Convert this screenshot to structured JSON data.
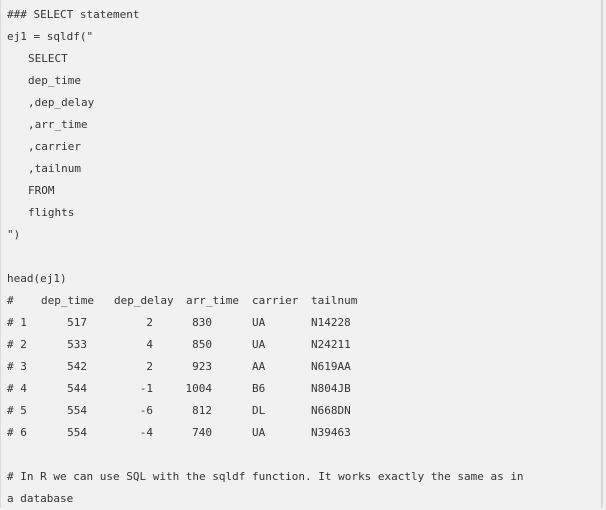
{
  "code": {
    "comment_header": "### SELECT statement",
    "assign_line": "ej1 = sqldf(\"",
    "sql_lines": [
      "SELECT",
      "dep_time",
      ",dep_delay",
      ",arr_time",
      ",carrier",
      ",tailnum",
      "FROM",
      "flights"
    ],
    "close_line": "\")",
    "head_call": "head(ej1)"
  },
  "output_table": {
    "row_prefix_header": "#",
    "columns": [
      "dep_time",
      "dep_delay",
      "arr_time",
      "carrier",
      "tailnum"
    ],
    "rows": [
      {
        "index": "# 1",
        "dep_time": "517",
        "dep_delay": "2",
        "arr_time": "830",
        "carrier": "UA",
        "tailnum": "N14228"
      },
      {
        "index": "# 2",
        "dep_time": "533",
        "dep_delay": "4",
        "arr_time": "850",
        "carrier": "UA",
        "tailnum": "N24211"
      },
      {
        "index": "# 3",
        "dep_time": "542",
        "dep_delay": "2",
        "arr_time": "923",
        "carrier": "AA",
        "tailnum": "N619AA"
      },
      {
        "index": "# 4",
        "dep_time": "544",
        "dep_delay": "-1",
        "arr_time": "1004",
        "carrier": "B6",
        "tailnum": "N804JB"
      },
      {
        "index": "# 5",
        "dep_time": "554",
        "dep_delay": "-6",
        "arr_time": "812",
        "carrier": "DL",
        "tailnum": "N668DN"
      },
      {
        "index": "# 6",
        "dep_time": "554",
        "dep_delay": "-4",
        "arr_time": "740",
        "carrier": "UA",
        "tailnum": "N39463"
      }
    ]
  },
  "footer_comment": {
    "line1": "# In R we can use SQL with the sqldf function. It works exactly the same as in",
    "line2": "a database"
  }
}
